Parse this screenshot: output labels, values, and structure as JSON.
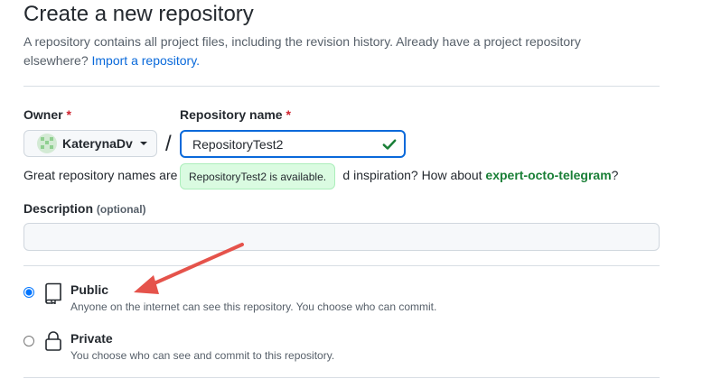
{
  "header": {
    "title": "Create a new repository",
    "subtitle": "A repository contains all project files, including the revision history. Already have a project repository elsewhere?",
    "import_link": "Import a repository."
  },
  "owner": {
    "label": "Owner",
    "required_mark": "*",
    "name": "KaterynaDv"
  },
  "separator": "/",
  "repo_name": {
    "label": "Repository name",
    "required_mark": "*",
    "value": "RepositoryTest2",
    "availability": "RepositoryTest2 is available."
  },
  "hint": {
    "text_before": "Great repository names are",
    "text_after": "d inspiration? How about",
    "suggestion": "expert-octo-telegram",
    "end": "?"
  },
  "description": {
    "label": "Description",
    "optional": "(optional)",
    "value": ""
  },
  "visibility": {
    "selected": "public",
    "public": {
      "title": "Public",
      "desc": "Anyone on the internet can see this repository. You choose who can commit.",
      "icon": "repo-icon"
    },
    "private": {
      "title": "Private",
      "desc": "You choose who can see and commit to this repository.",
      "icon": "lock-icon"
    }
  },
  "colors": {
    "link": "#0969da",
    "success": "#1a7f37",
    "required": "#cf222e",
    "annotation_arrow": "#e5534b"
  }
}
